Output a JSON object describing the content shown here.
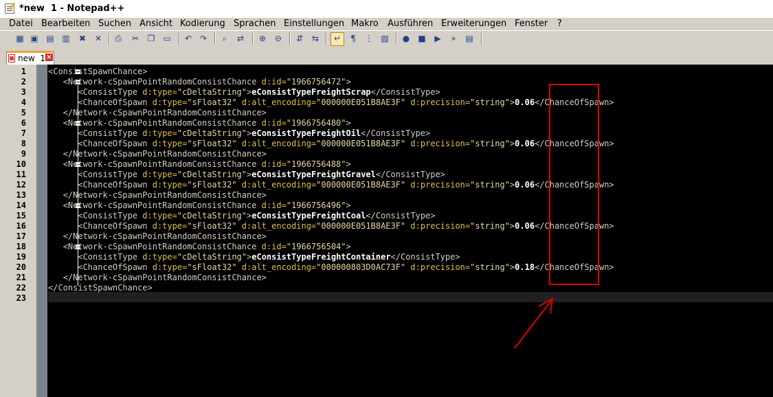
{
  "window": {
    "title": "*new  1 - Notepad++"
  },
  "menu": [
    "Datei",
    "Bearbeiten",
    "Suchen",
    "Ansicht",
    "Kodierung",
    "Sprachen",
    "Einstellungen",
    "Makro",
    "Ausführen",
    "Erweiterungen",
    "Fenster",
    "?"
  ],
  "toolbar": {
    "icons": [
      "new-file-icon",
      "open-file-icon",
      "save-icon",
      "save-all-icon",
      "close-icon",
      "close-all-icon",
      "print-icon",
      "cut-icon",
      "copy-icon",
      "paste-icon",
      "undo-icon",
      "redo-icon",
      "find-icon",
      "replace-icon",
      "zoom-in-icon",
      "zoom-out-icon",
      "sync-vertical-icon",
      "sync-horizontal-icon",
      "word-wrap-icon",
      "show-all-chars-icon",
      "indent-guide-icon",
      "document-map-icon",
      "record-macro-icon",
      "stop-record-icon",
      "play-macro-icon",
      "run-macro-multiple-icon",
      "save-macro-icon"
    ]
  },
  "tab": {
    "label": "new  1"
  },
  "editor": {
    "lines": [
      {
        "n": "1",
        "segs": [
          [
            "tag",
            "<ConsistSpawnChance>"
          ]
        ]
      },
      {
        "n": "2",
        "segs": [
          [
            "txt",
            "   "
          ],
          [
            "tag",
            "<Network-cSpawnPointRandomConsistChance "
          ],
          [
            "attr",
            "d:id="
          ],
          [
            "val",
            "\"1966756472\""
          ],
          [
            "tag",
            ">"
          ]
        ]
      },
      {
        "n": "3",
        "segs": [
          [
            "txt",
            "      "
          ],
          [
            "tag",
            "<ConsistType "
          ],
          [
            "attr",
            "d:type="
          ],
          [
            "val",
            "\"cDeltaString\""
          ],
          [
            "tag",
            ">"
          ],
          [
            "txt",
            "eConsistTypeFreightScrap"
          ],
          [
            "tag",
            "</ConsistType>"
          ]
        ]
      },
      {
        "n": "4",
        "segs": [
          [
            "txt",
            "      "
          ],
          [
            "tag",
            "<ChanceOfSpawn "
          ],
          [
            "attr",
            "d:type="
          ],
          [
            "val",
            "\"sFloat32\""
          ],
          [
            "attr",
            " d:alt_encoding="
          ],
          [
            "val",
            "\"000000E051B8AE3F\""
          ],
          [
            "attr",
            " d:precision="
          ],
          [
            "val",
            "\"string\""
          ],
          [
            "tag",
            ">"
          ],
          [
            "txt",
            "0.06"
          ],
          [
            "tag",
            "</ChanceOfSpawn>"
          ]
        ]
      },
      {
        "n": "5",
        "segs": [
          [
            "txt",
            "   "
          ],
          [
            "tag",
            "</Network-cSpawnPointRandomConsistChance>"
          ]
        ]
      },
      {
        "n": "6",
        "segs": [
          [
            "txt",
            "   "
          ],
          [
            "tag",
            "<Network-cSpawnPointRandomConsistChance "
          ],
          [
            "attr",
            "d:id="
          ],
          [
            "val",
            "\"1966756480\""
          ],
          [
            "tag",
            ">"
          ]
        ]
      },
      {
        "n": "7",
        "segs": [
          [
            "txt",
            "      "
          ],
          [
            "tag",
            "<ConsistType "
          ],
          [
            "attr",
            "d:type="
          ],
          [
            "val",
            "\"cDeltaString\""
          ],
          [
            "tag",
            ">"
          ],
          [
            "txt",
            "eConsistTypeFreightOil"
          ],
          [
            "tag",
            "</ConsistType>"
          ]
        ]
      },
      {
        "n": "8",
        "segs": [
          [
            "txt",
            "      "
          ],
          [
            "tag",
            "<ChanceOfSpawn "
          ],
          [
            "attr",
            "d:type="
          ],
          [
            "val",
            "\"sFloat32\""
          ],
          [
            "attr",
            " d:alt_encoding="
          ],
          [
            "val",
            "\"000000E051B8AE3F\""
          ],
          [
            "attr",
            " d:precision="
          ],
          [
            "val",
            "\"string\""
          ],
          [
            "tag",
            ">"
          ],
          [
            "txt",
            "0.06"
          ],
          [
            "tag",
            "</ChanceOfSpawn>"
          ]
        ]
      },
      {
        "n": "9",
        "segs": [
          [
            "txt",
            "   "
          ],
          [
            "tag",
            "</Network-cSpawnPointRandomConsistChance>"
          ]
        ]
      },
      {
        "n": "10",
        "segs": [
          [
            "txt",
            "   "
          ],
          [
            "tag",
            "<Network-cSpawnPointRandomConsistChance "
          ],
          [
            "attr",
            "d:id="
          ],
          [
            "val",
            "\"1966756488\""
          ],
          [
            "tag",
            ">"
          ]
        ]
      },
      {
        "n": "11",
        "segs": [
          [
            "txt",
            "      "
          ],
          [
            "tag",
            "<ConsistType "
          ],
          [
            "attr",
            "d:type="
          ],
          [
            "val",
            "\"cDeltaString\""
          ],
          [
            "tag",
            ">"
          ],
          [
            "txt",
            "eConsistTypeFreightGravel"
          ],
          [
            "tag",
            "</ConsistType>"
          ]
        ]
      },
      {
        "n": "12",
        "segs": [
          [
            "txt",
            "      "
          ],
          [
            "tag",
            "<ChanceOfSpawn "
          ],
          [
            "attr",
            "d:type="
          ],
          [
            "val",
            "\"sFloat32\""
          ],
          [
            "attr",
            " d:alt_encoding="
          ],
          [
            "val",
            "\"000000E051B8AE3F\""
          ],
          [
            "attr",
            " d:precision="
          ],
          [
            "val",
            "\"string\""
          ],
          [
            "tag",
            ">"
          ],
          [
            "txt",
            "0.06"
          ],
          [
            "tag",
            "</ChanceOfSpawn>"
          ]
        ]
      },
      {
        "n": "13",
        "segs": [
          [
            "txt",
            "   "
          ],
          [
            "tag",
            "</Network-cSpawnPointRandomConsistChance>"
          ]
        ]
      },
      {
        "n": "14",
        "segs": [
          [
            "txt",
            "   "
          ],
          [
            "tag",
            "<Network-cSpawnPointRandomConsistChance "
          ],
          [
            "attr",
            "d:id="
          ],
          [
            "val",
            "\"1966756496\""
          ],
          [
            "tag",
            ">"
          ]
        ]
      },
      {
        "n": "15",
        "segs": [
          [
            "txt",
            "      "
          ],
          [
            "tag",
            "<ConsistType "
          ],
          [
            "attr",
            "d:type="
          ],
          [
            "val",
            "\"cDeltaString\""
          ],
          [
            "tag",
            ">"
          ],
          [
            "txt",
            "eConsistTypeFreightCoal"
          ],
          [
            "tag",
            "</ConsistType>"
          ]
        ]
      },
      {
        "n": "16",
        "segs": [
          [
            "txt",
            "      "
          ],
          [
            "tag",
            "<ChanceOfSpawn "
          ],
          [
            "attr",
            "d:type="
          ],
          [
            "val",
            "\"sFloat32\""
          ],
          [
            "attr",
            " d:alt_encoding="
          ],
          [
            "val",
            "\"000000E051B8AE3F\""
          ],
          [
            "attr",
            " d:precision="
          ],
          [
            "val",
            "\"string\""
          ],
          [
            "tag",
            ">"
          ],
          [
            "txt",
            "0.06"
          ],
          [
            "tag",
            "</ChanceOfSpawn>"
          ]
        ]
      },
      {
        "n": "17",
        "segs": [
          [
            "txt",
            "   "
          ],
          [
            "tag",
            "</Network-cSpawnPointRandomConsistChance>"
          ]
        ]
      },
      {
        "n": "18",
        "segs": [
          [
            "txt",
            "   "
          ],
          [
            "tag",
            "<Network-cSpawnPointRandomConsistChance "
          ],
          [
            "attr",
            "d:id="
          ],
          [
            "val",
            "\"1966756504\""
          ],
          [
            "tag",
            ">"
          ]
        ]
      },
      {
        "n": "19",
        "segs": [
          [
            "txt",
            "      "
          ],
          [
            "tag",
            "<ConsistType "
          ],
          [
            "attr",
            "d:type="
          ],
          [
            "val",
            "\"cDeltaString\""
          ],
          [
            "tag",
            ">"
          ],
          [
            "txt",
            "eConsistTypeFreightContainer"
          ],
          [
            "tag",
            "</ConsistType>"
          ]
        ]
      },
      {
        "n": "20",
        "segs": [
          [
            "txt",
            "      "
          ],
          [
            "tag",
            "<ChanceOfSpawn "
          ],
          [
            "attr",
            "d:type="
          ],
          [
            "val",
            "\"sFloat32\""
          ],
          [
            "attr",
            " d:alt_encoding="
          ],
          [
            "val",
            "\"000000803D0AC73F\""
          ],
          [
            "attr",
            " d:precision="
          ],
          [
            "val",
            "\"string\""
          ],
          [
            "tag",
            ">"
          ],
          [
            "txt",
            "0.18"
          ],
          [
            "tag",
            "</ChanceOfSpawn>"
          ]
        ]
      },
      {
        "n": "21",
        "segs": [
          [
            "txt",
            "   "
          ],
          [
            "tag",
            "</Network-cSpawnPointRandomConsistChance>"
          ]
        ]
      },
      {
        "n": "22",
        "segs": [
          [
            "tag",
            "</ConsistSpawnChance>"
          ]
        ]
      },
      {
        "n": "23",
        "segs": []
      }
    ],
    "fold_lines": [
      "1",
      "2",
      "6",
      "10",
      "14",
      "18"
    ]
  },
  "colors": {
    "tag": "#d0d0c0",
    "attribute": "#e0c040",
    "value": "#e8d8a0",
    "text": "#ffffff",
    "annotation": "#e00000"
  }
}
